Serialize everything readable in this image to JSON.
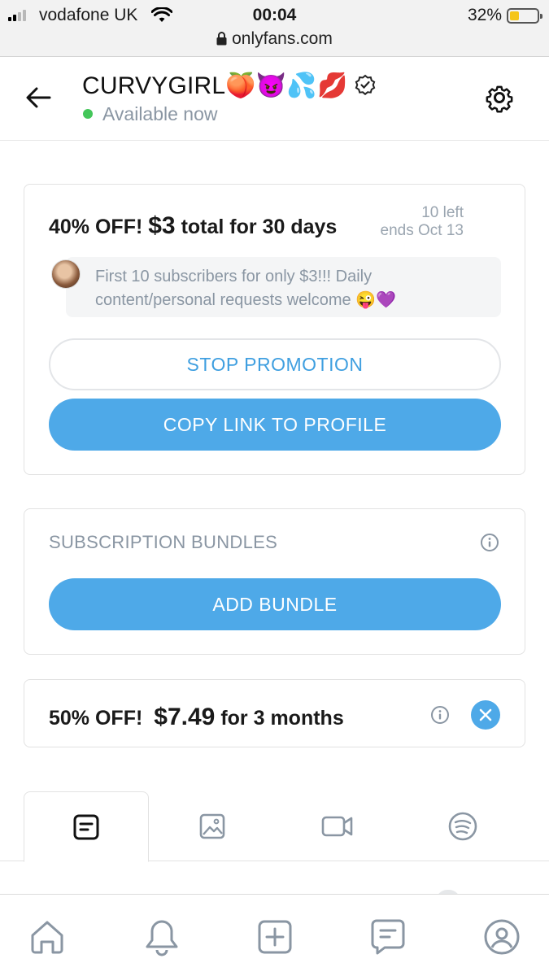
{
  "status_bar": {
    "carrier": "vodafone UK",
    "time": "00:04",
    "battery": "32%",
    "battery_level": 0.32,
    "signal_bars_filled": 2
  },
  "browser": {
    "url": "onlyfans.com"
  },
  "header": {
    "title": "CURVYGIRL🍑😈💦💋",
    "status": "Available now"
  },
  "promotion": {
    "title_prefix": "40% OFF!",
    "price": "$3",
    "title_suffix": "total for 30 days",
    "left": "10 left",
    "ends": "ends Oct 13",
    "message": "First 10 subscribers for only $3!!! Daily content/personal requests welcome 😜💜",
    "stop_label": "STOP PROMOTION",
    "copy_label": "COPY LINK TO PROFILE"
  },
  "bundles": {
    "title": "SUBSCRIPTION BUNDLES",
    "add_label": "ADD BUNDLE"
  },
  "discount": {
    "prefix": "50% OFF!",
    "price": "$7.49",
    "suffix": "for 3 months"
  },
  "tabs": [
    {
      "icon": "posts-icon",
      "active": true
    },
    {
      "icon": "photos-icon",
      "active": false
    },
    {
      "icon": "videos-icon",
      "active": false
    },
    {
      "icon": "spotify-icon",
      "active": false
    }
  ],
  "bottom_nav": [
    "home-icon",
    "bell-icon",
    "add-post-icon",
    "messages-icon",
    "profile-icon"
  ],
  "colors": {
    "accent": "#4ea9e8",
    "online": "#44c65a",
    "muted": "#8a96a3"
  }
}
